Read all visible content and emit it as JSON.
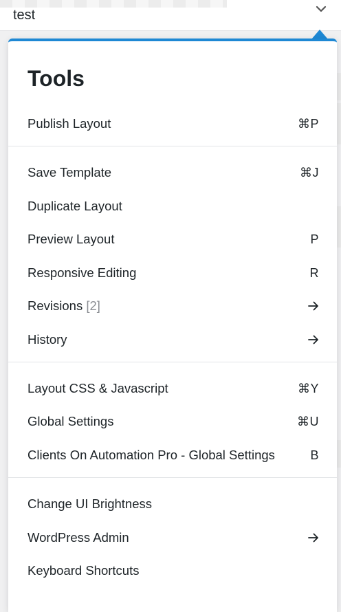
{
  "topbar": {
    "title": "test"
  },
  "menu": {
    "title": "Tools",
    "sections": [
      [
        {
          "label": "Publish Layout",
          "shortcut": "⌘P"
        }
      ],
      [
        {
          "label": "Save Template",
          "shortcut": "⌘J"
        },
        {
          "label": "Duplicate Layout",
          "shortcut": ""
        },
        {
          "label": "Preview Layout",
          "shortcut": "P"
        },
        {
          "label": "Responsive Editing",
          "shortcut": "R"
        },
        {
          "label": "Revisions",
          "count": "[2]",
          "icon": "arrow-right-icon"
        },
        {
          "label": "History",
          "icon": "arrow-right-icon"
        }
      ],
      [
        {
          "label": "Layout CSS & Javascript",
          "shortcut": "⌘Y"
        },
        {
          "label": "Global Settings",
          "shortcut": "⌘U"
        },
        {
          "label": "Clients On Automation Pro - Global Settings",
          "shortcut": "B"
        }
      ],
      [
        {
          "label": "Change UI Brightness",
          "shortcut": ""
        },
        {
          "label": "WordPress Admin",
          "icon": "arrow-right-icon"
        },
        {
          "label": "Keyboard Shortcuts",
          "shortcut": ""
        }
      ]
    ]
  },
  "colors": {
    "accent": "#1e88d4",
    "text": "#1d2327",
    "muted": "#8c8f94"
  }
}
